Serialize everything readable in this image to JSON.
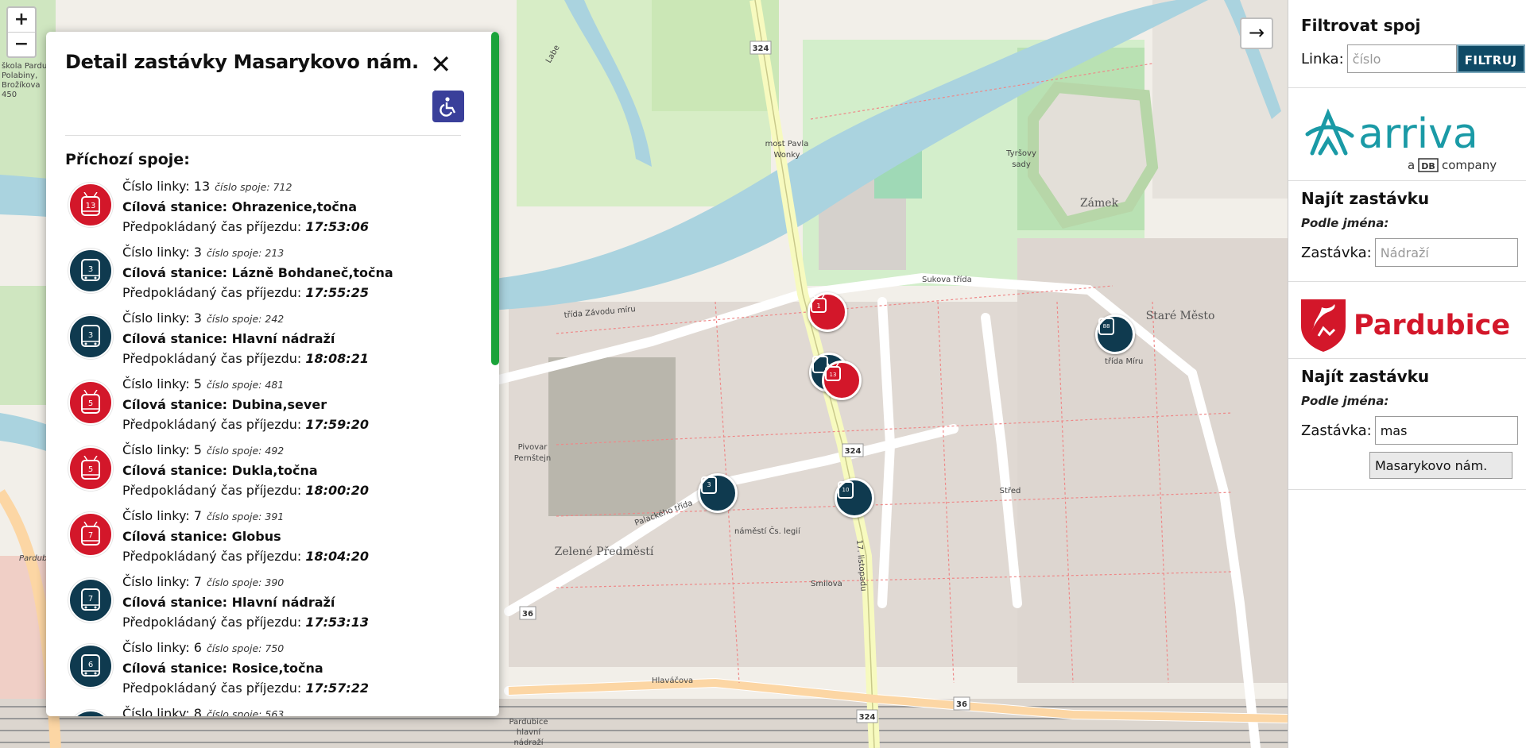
{
  "map": {
    "zoom_in": "+",
    "zoom_out": "−",
    "collapse": "→",
    "labels": {
      "most": "most Pavla",
      "most2": "Wonky",
      "tyrsovy": "Tyršovy",
      "sady": "sady",
      "zamek": "Zámek",
      "stare_mesto": "Staré Město",
      "stred": "Střed",
      "zelene": "Zelené Předměstí",
      "pivovar": "Pivovar",
      "pernstejn": "Pernštejn",
      "road324a": "324",
      "road324b": "324",
      "road324c": "324",
      "road36a": "36",
      "road36b": "36",
      "sukova": "Sukova třída",
      "tridamiru": "třída Míru",
      "hlavacova": "Hlaváčova",
      "palackeho": "Palackého třída",
      "smilova": "Smilova",
      "namesti": "náměstí Čs. legií",
      "hlavni1": "Pardubice",
      "hlavni2": "hlavní",
      "hlavni3": "nádraží",
      "skola1": "škola Pardub",
      "skola2": "Polabiny,",
      "skola3": "Brožíkova",
      "skola4": "450",
      "labe": "Labe",
      "zavodu": "třída Závodu míru",
      "listopadu": "17. listopadu",
      "pardubice_lbl": "Pardubi"
    },
    "markers": [
      {
        "type": "trolley",
        "line": "1"
      },
      {
        "type": "bus",
        "line": "88"
      },
      {
        "type": "bus",
        "line": ""
      },
      {
        "type": "trolley",
        "line": "13"
      },
      {
        "type": "bus",
        "line": "3"
      },
      {
        "type": "bus",
        "line": "10"
      }
    ]
  },
  "detail": {
    "title": "Detail zastávky Masarykovo nám.",
    "close_icon": "✕",
    "incoming_heading": "Příchozí spoje:",
    "line_prefix": "Číslo linky: ",
    "trip_prefix": "číslo spoje: ",
    "dest_prefix": "Cílová stanice: ",
    "time_prefix": "Předpokládaný čas příjezdu: ",
    "connections": [
      {
        "type": "trolley",
        "line": "13",
        "trip": "712",
        "dest": "Ohrazenice,točna",
        "time": "17:53:06"
      },
      {
        "type": "bus",
        "line": "3",
        "trip": "213",
        "dest": "Lázně Bohdaneč,točna",
        "time": "17:55:25"
      },
      {
        "type": "bus",
        "line": "3",
        "trip": "242",
        "dest": "Hlavní nádraží",
        "time": "18:08:21"
      },
      {
        "type": "trolley",
        "line": "5",
        "trip": "481",
        "dest": "Dubina,sever",
        "time": "17:59:20"
      },
      {
        "type": "trolley",
        "line": "5",
        "trip": "492",
        "dest": "Dukla,točna",
        "time": "18:00:20"
      },
      {
        "type": "trolley",
        "line": "7",
        "trip": "391",
        "dest": "Globus",
        "time": "18:04:20"
      },
      {
        "type": "bus",
        "line": "7",
        "trip": "390",
        "dest": "Hlavní nádraží",
        "time": "17:53:13"
      },
      {
        "type": "bus",
        "line": "6",
        "trip": "750",
        "dest": "Rosice,točna",
        "time": "17:57:22"
      },
      {
        "type": "bus",
        "line": "8",
        "trip": "563",
        "dest": "",
        "time": ""
      }
    ]
  },
  "sidebar": {
    "filter_title": "Filtrovat spoj",
    "line_label": "Linka:",
    "line_placeholder": "číslo",
    "filter_button": "FILTRUJ",
    "arriva_word": "arriva",
    "arriva_sub_a": "a",
    "arriva_sub_db": "DB",
    "arriva_sub_company": "company",
    "find_stop_1": "Najít zastávku",
    "by_name_1": "Podle jména:",
    "stop_label_1": "Zastávka:",
    "stop_placeholder_1": "Nádraží",
    "pardubice_word": "Pardubice",
    "find_stop_2": "Najít zastávku",
    "by_name_2": "Podle jména:",
    "stop_label_2": "Zastávka:",
    "stop_value_2": "mas",
    "suggestion": "Masarykovo nám.",
    "colors": {
      "arriva": "#1a9aa6",
      "pardubice": "#d3172a",
      "button": "#0f4a66"
    }
  }
}
